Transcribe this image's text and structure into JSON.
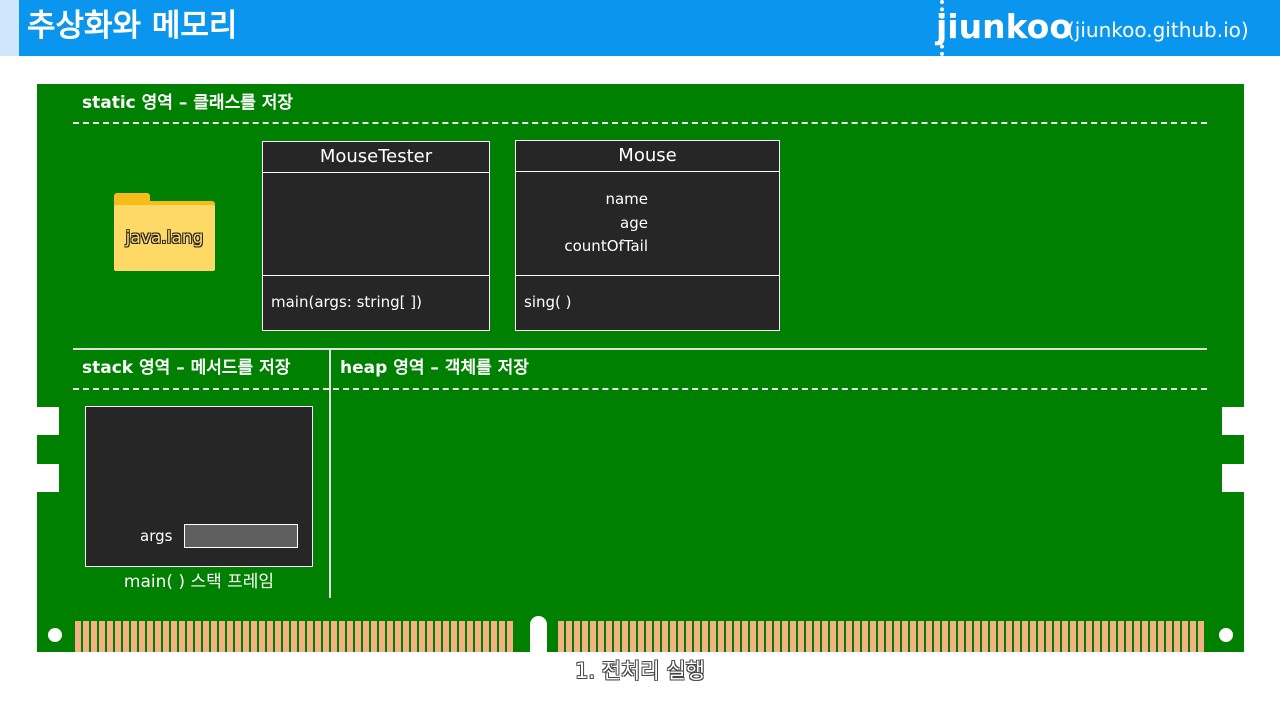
{
  "header": {
    "title": "추상화와 메모리",
    "brand": "jiunkoo",
    "brand_url": "(jiunkoo.github.io)"
  },
  "static_area": {
    "label": "static 영역 – 클래스를 저장",
    "folder_label": "java.lang",
    "classes": [
      {
        "name": "MouseTester",
        "fields": [],
        "methods": [
          "main(args: string[ ])"
        ]
      },
      {
        "name": "Mouse",
        "fields": [
          "name",
          "age",
          "countOfTail"
        ],
        "methods": [
          "sing( )"
        ]
      }
    ]
  },
  "stack_area": {
    "label": "stack 영역 – 메서드를 저장",
    "frame_variable": "args",
    "frame_caption": "main( ) 스택 프레임"
  },
  "heap_area": {
    "label": "heap 영역 – 객체를 저장"
  },
  "caption": "1. 전처리 실행",
  "colors": {
    "header_bg": "#0a95ee",
    "board_bg": "#008000",
    "box_bg": "#262626",
    "folder": "#ffd966",
    "pins": "#f4b183"
  }
}
